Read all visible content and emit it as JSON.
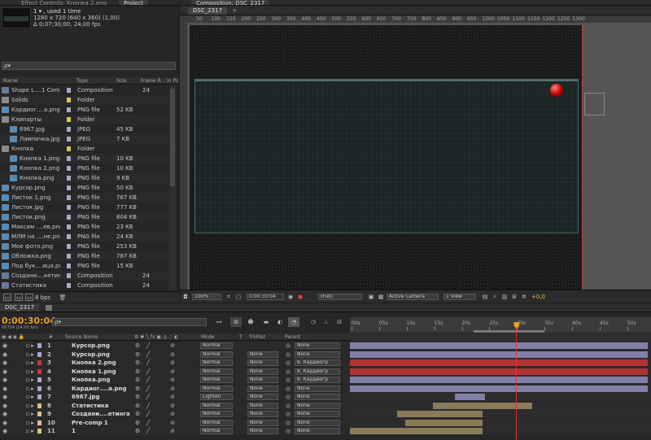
{
  "project": {
    "tab_effects": "Effect Controls: Кнопка 2.png",
    "tab_project": "Project",
    "usage": "1 ▾ , used 1 time",
    "size": "1280 x 720  (640 x 360) (1,00)",
    "duration": "Δ 0;07;30;00, 24,00 fps",
    "search_placeholder": "ρ▾",
    "columns": {
      "name": "Name",
      "type": "Type",
      "size": "Size",
      "frame_rate": "Frame R...",
      "in_point": "In Pc"
    },
    "items": [
      {
        "name": "Shape L....1 Comp 1",
        "type": "Composition",
        "size": "",
        "fps": "24",
        "icon": "comp-icon",
        "color": "#a9a9c9",
        "indent": 0
      },
      {
        "name": "Solids",
        "type": "Folder",
        "size": "",
        "fps": "",
        "icon": "folder-icon",
        "color": "#d8c84c",
        "indent": 0
      },
      {
        "name": "Кардиог....а.png",
        "type": "PNG file",
        "size": "52 KB",
        "fps": "",
        "icon": "image-icon",
        "color": "#a9a9c9",
        "indent": 0
      },
      {
        "name": "Клипарты",
        "type": "Folder",
        "size": "",
        "fps": "",
        "icon": "folder-icon",
        "color": "#d8c84c",
        "indent": 0
      },
      {
        "name": "6967.jpg",
        "type": "JPEG",
        "size": "45 KB",
        "fps": "",
        "icon": "image-icon",
        "color": "#a9a9c9",
        "indent": 1
      },
      {
        "name": "Лампочка.jpg",
        "type": "JPEG",
        "size": "7 KB",
        "fps": "",
        "icon": "image-icon",
        "color": "#a9a9c9",
        "indent": 1
      },
      {
        "name": "Кнопка",
        "type": "Folder",
        "size": "",
        "fps": "",
        "icon": "folder-icon",
        "color": "#d8c84c",
        "indent": 0
      },
      {
        "name": "Кнопка 1.png",
        "type": "PNG file",
        "size": "10 KB",
        "fps": "",
        "icon": "image-icon",
        "color": "#a9a9c9",
        "indent": 1
      },
      {
        "name": "Кнопка 2.png",
        "type": "PNG file",
        "size": "10 KB",
        "fps": "",
        "icon": "image-icon",
        "color": "#a9a9c9",
        "indent": 1
      },
      {
        "name": "Кнопка.png",
        "type": "PNG file",
        "size": "9 KB",
        "fps": "",
        "icon": "image-icon",
        "color": "#a9a9c9",
        "indent": 1
      },
      {
        "name": "Курсор.png",
        "type": "PNG file",
        "size": "50 KB",
        "fps": "",
        "icon": "image-icon",
        "color": "#a9a9c9",
        "indent": 0
      },
      {
        "name": "Листок 1.png",
        "type": "PNG file",
        "size": "767 KB",
        "fps": "",
        "icon": "image-icon",
        "color": "#a9a9c9",
        "indent": 0
      },
      {
        "name": "Листок.jpg",
        "type": "PNG file",
        "size": "777 KB",
        "fps": "",
        "icon": "image-icon",
        "color": "#a9a9c9",
        "indent": 0
      },
      {
        "name": "Листок.png",
        "type": "PNG file",
        "size": "804 KB",
        "fps": "",
        "icon": "image-icon",
        "color": "#a9a9c9",
        "indent": 0
      },
      {
        "name": "Максим ....ев.png",
        "type": "PNG file",
        "size": "23 KB",
        "fps": "",
        "icon": "image-icon",
        "color": "#a9a9c9",
        "indent": 0
      },
      {
        "name": "МЛМ на ....не.png",
        "type": "PNG file",
        "size": "24 KB",
        "fps": "",
        "icon": "image-icon",
        "color": "#a9a9c9",
        "indent": 0
      },
      {
        "name": "Мое фото.png",
        "type": "PNG file",
        "size": "253 KB",
        "fps": "",
        "icon": "image-icon",
        "color": "#a9a9c9",
        "indent": 0
      },
      {
        "name": "Обложка.png",
        "type": "PNG file",
        "size": "787 KB",
        "fps": "",
        "icon": "image-icon",
        "color": "#a9a9c9",
        "indent": 0
      },
      {
        "name": "Под бук....ица.png",
        "type": "PNG file",
        "size": "15 KB",
        "fps": "",
        "icon": "image-icon",
        "color": "#a9a9c9",
        "indent": 0
      },
      {
        "name": "Создани....кетинга",
        "type": "Composition",
        "size": "",
        "fps": "24",
        "icon": "comp-icon",
        "color": "#a9a9c9",
        "indent": 0
      },
      {
        "name": "Статистика",
        "type": "Composition",
        "size": "",
        "fps": "24",
        "icon": "comp-icon",
        "color": "#a9a9c9",
        "indent": 0
      }
    ],
    "bpc": "8 bpc"
  },
  "composition": {
    "tab_label": "Composition: DSC_2317",
    "sub_tab": "DSC_2317",
    "ruler_ticks": [
      "50",
      "100",
      "150",
      "200",
      "250",
      "300",
      "350",
      "400",
      "450",
      "500",
      "550",
      "600",
      "650",
      "700",
      "750",
      "800",
      "850",
      "900",
      "950",
      "1000",
      "1050",
      "1100",
      "1150",
      "1200",
      "1250",
      "1300"
    ],
    "zoom": "100%",
    "timecode": "0:00:30:04",
    "resolution": "(Full)",
    "camera": "Active Camera",
    "view": "1 View",
    "offset": "+0,0"
  },
  "timeline": {
    "tab_label": "DSC_2317",
    "timecode": "0:00:30:04",
    "frame_info": "00724 (24.00 fps)",
    "search_placeholder": "ρ▾",
    "columns": {
      "num": "#",
      "source": "Source Name",
      "mode": "Mode",
      "t": "T",
      "trkmat": "TrkMat",
      "parent": "Parent"
    },
    "ruler_ticks": [
      "00s",
      "05s",
      "10s",
      "15s",
      "20s",
      "25s",
      "30s",
      "35s",
      "40s",
      "45s",
      "50s"
    ],
    "playhead_seconds": 30.17,
    "total_seconds": 54,
    "layers": [
      {
        "num": "1",
        "name": "Курсор.png",
        "mode": "Normal",
        "trkmat": "",
        "parent": "None",
        "label_color": "#a9a9c9",
        "bar_start": 0,
        "bar_end": 54,
        "bar_color": "#8080a8"
      },
      {
        "num": "2",
        "name": "Курсор.png",
        "mode": "Normal",
        "trkmat": "None",
        "parent": "None",
        "label_color": "#a9a9c9",
        "bar_start": 0,
        "bar_end": 54,
        "bar_color": "#8080a8"
      },
      {
        "num": "3",
        "name": "Кнопка 2.png",
        "mode": "Normal",
        "trkmat": "None",
        "parent": "6. Кардиогр",
        "label_color": "#c83a3a",
        "bar_start": 0,
        "bar_end": 54,
        "bar_color": "#b03434"
      },
      {
        "num": "4",
        "name": "Кнопка 1.png",
        "mode": "Normal",
        "trkmat": "None",
        "parent": "6. Кардиогр",
        "label_color": "#c83a3a",
        "bar_start": 0,
        "bar_end": 54,
        "bar_color": "#b03434"
      },
      {
        "num": "5",
        "name": "Кнопка.png",
        "mode": "Normal",
        "trkmat": "None",
        "parent": "6. Кардиогр",
        "label_color": "#a9a9c9",
        "bar_start": 0,
        "bar_end": 54,
        "bar_color": "#8080a8"
      },
      {
        "num": "6",
        "name": "Кардиог....а.png",
        "mode": "Normal",
        "trkmat": "None",
        "parent": "None",
        "label_color": "#a9a9c9",
        "bar_start": 0,
        "bar_end": 54,
        "bar_color": "#8080a8"
      },
      {
        "num": "7",
        "name": "6967.jpg",
        "mode": "Lighten",
        "trkmat": "None",
        "parent": "None",
        "label_color": "#a9a9c9",
        "bar_start": 19,
        "bar_end": 24.5,
        "bar_color": "#8080a8"
      },
      {
        "num": "8",
        "name": "Статистика",
        "mode": "Normal",
        "trkmat": "None",
        "parent": "None",
        "label_color": "#d8c08c",
        "bar_start": 15,
        "bar_end": 33,
        "bar_color": "#8a7a5a"
      },
      {
        "num": "9",
        "name": "Создани....етинга",
        "mode": "Normal",
        "trkmat": "None",
        "parent": "None",
        "label_color": "#d8c08c",
        "bar_start": 8.5,
        "bar_end": 24,
        "bar_color": "#8a7a5a"
      },
      {
        "num": "10",
        "name": "Pre-comp 1",
        "mode": "Normal",
        "trkmat": "None",
        "parent": "None",
        "label_color": "#d8c08c",
        "bar_start": 10,
        "bar_end": 24,
        "bar_color": "#8a7a5a"
      },
      {
        "num": "11",
        "name": "1",
        "mode": "Normal",
        "trkmat": "None",
        "parent": "None",
        "label_color": "#d8c08c",
        "bar_start": 0,
        "bar_end": 24,
        "bar_color": "#8a7a5a"
      }
    ]
  }
}
